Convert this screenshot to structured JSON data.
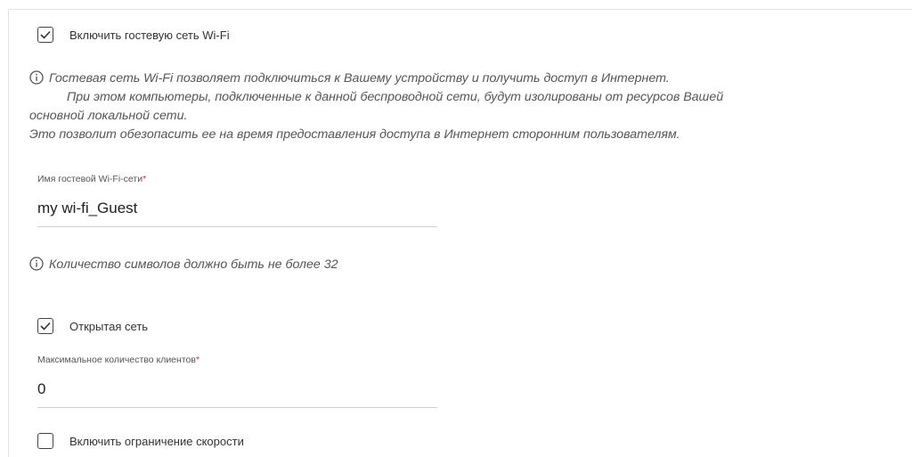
{
  "guest_wifi": {
    "enable_label": "Включить гостевую сеть Wi-Fi",
    "enable_checked": true,
    "info_line1": "Гостевая сеть Wi-Fi позволяет подключиться к Вашему устройству и получить доступ в Интернет.",
    "info_line2": "При этом компьютеры, подключенные к данной беспроводной сети, будут изолированы от ресурсов Вашей",
    "info_line3": "основной локальной сети.",
    "info_line4": "Это позволит обезопасить ее на время предоставления доступа в Интернет сторонним пользователям."
  },
  "ssid": {
    "label": "Имя гостевой Wi-Fi-сети",
    "required_mark": "*",
    "value": "my wi-fi_Guest",
    "hint": "Количество символов должно быть не более 32"
  },
  "open_network": {
    "label": "Открытая сеть",
    "checked": true
  },
  "max_clients": {
    "label": "Максимальное количество клиентов",
    "required_mark": "*",
    "value": "0"
  },
  "speed_limit": {
    "label": "Включить ограничение скорости",
    "checked": false
  }
}
